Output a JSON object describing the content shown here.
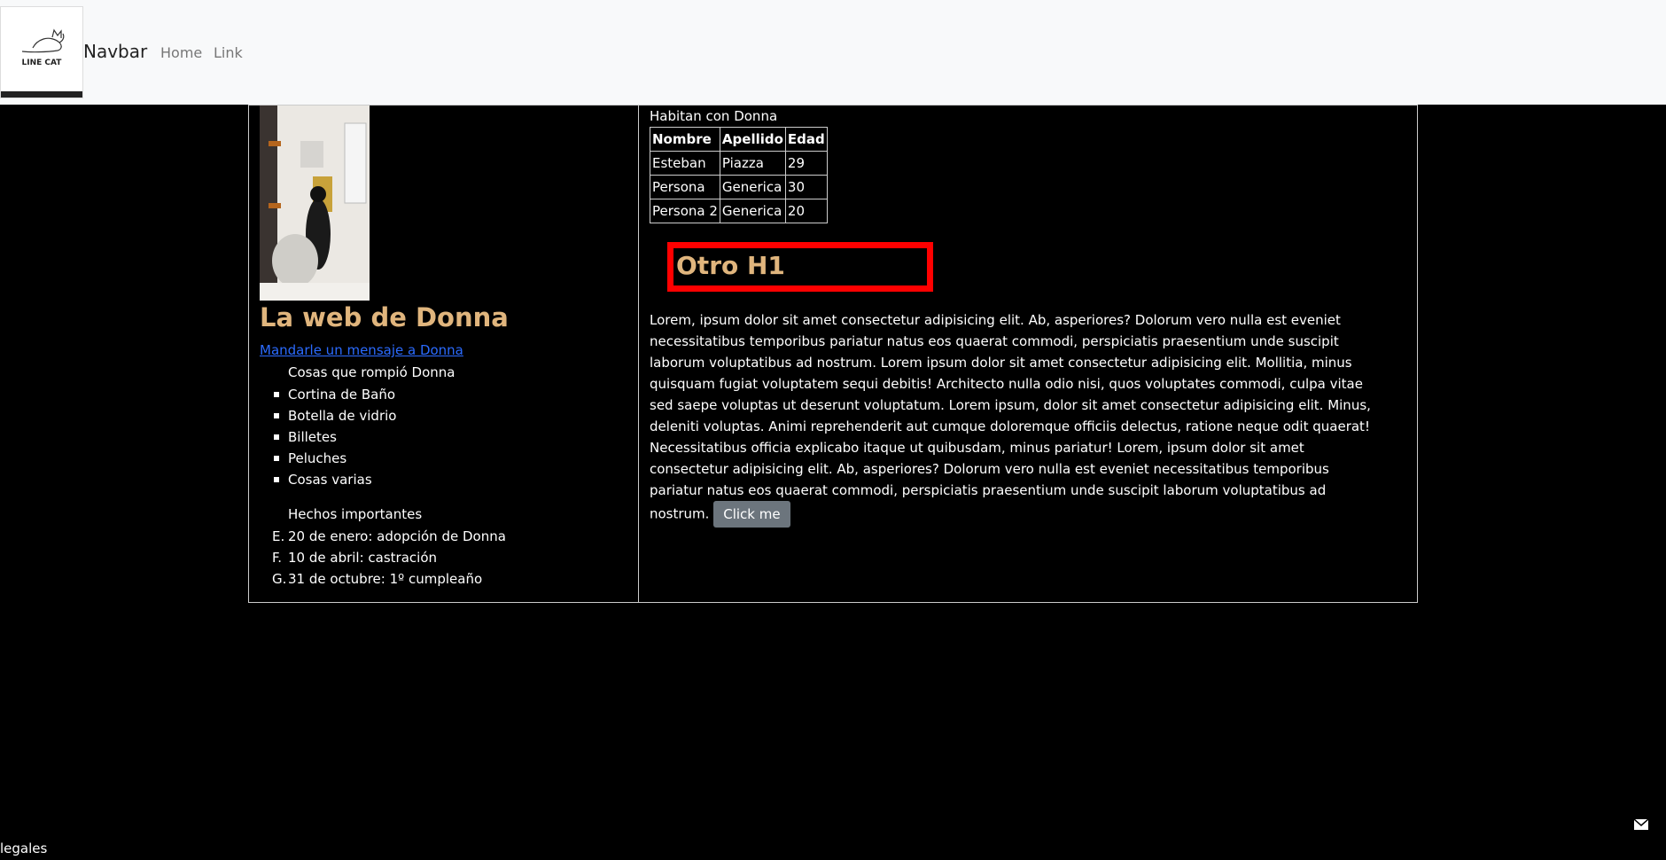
{
  "navbar": {
    "logo_text": "LINE CAT",
    "brand": "Navbar",
    "links": [
      {
        "label": "Home"
      },
      {
        "label": "Link"
      }
    ]
  },
  "left": {
    "site_title": "La web de Donna",
    "message_link": "Mandarle un mensaje a Donna",
    "broken_title": "Cosas que rompió Donna",
    "broken_items": [
      "Cortina de Baño",
      "Botella de vidrio",
      "Billetes",
      "Peluches",
      "Cosas varias"
    ],
    "facts_title": "Hechos importantes",
    "facts": [
      {
        "marker": "E.",
        "text": "20 de enero: adopción de Donna"
      },
      {
        "marker": "F.",
        "text": "10 de abril: castración"
      },
      {
        "marker": "G.",
        "text": "31 de octubre: 1º cumpleaño"
      }
    ]
  },
  "right": {
    "table_caption": "Habitan con Donna",
    "table_headers": [
      "Nombre",
      "Apellido",
      "Edad"
    ],
    "table_rows": [
      [
        "Esteban",
        "Piazza",
        "29"
      ],
      [
        "Persona",
        "Generica",
        "30"
      ],
      [
        "Persona 2",
        "Generica",
        "20"
      ]
    ],
    "h1": "Otro H1",
    "paragraph": "Lorem, ipsum dolor sit amet consectetur adipisicing elit. Ab, asperiores? Dolorum vero nulla est eveniet necessitatibus temporibus pariatur natus eos quaerat commodi, perspiciatis praesentium unde suscipit laborum voluptatibus ad nostrum. Lorem ipsum dolor sit amet consectetur adipisicing elit. Mollitia, minus quisquam fugiat voluptatem sequi debitis! Architecto nulla odio nisi, quos voluptates commodi, culpa vitae sed saepe voluptas ut deserunt voluptatum. Lorem ipsum, dolor sit amet consectetur adipisicing elit. Minus, deleniti voluptas. Animi reprehenderit aut cumque doloremque officiis delectus, ratione neque odit quaerat! Necessitatibus officia explicabo itaque ut quibusdam, minus pariatur! Lorem, ipsum dolor sit amet consectetur adipisicing elit. Ab, asperiores? Dolorum vero nulla est eveniet necessitatibus temporibus pariatur natus eos quaerat commodi, perspiciatis praesentium unde suscipit laborum voluptatibus ad nostrum.",
    "button_label": "Click me"
  },
  "footer": {
    "legales": "legales"
  },
  "colors": {
    "heading": "#e0b57d",
    "link": "#2b6bff",
    "highlight_border": "#ff0000",
    "button": "#6c757d"
  }
}
